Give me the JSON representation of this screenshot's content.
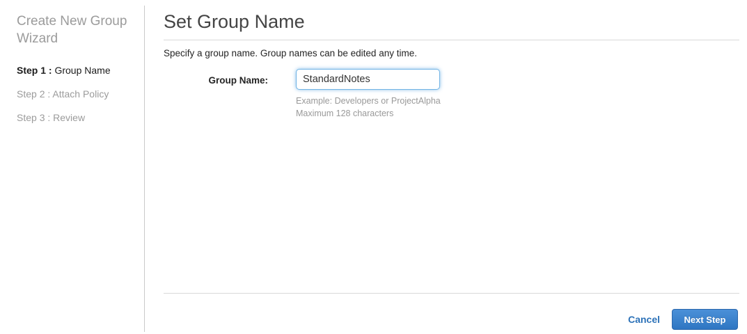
{
  "sidebar": {
    "title": "Create New Group Wizard",
    "steps": [
      {
        "prefix": "Step 1 :",
        "label": "Group Name",
        "active": true
      },
      {
        "prefix": "Step 2 :",
        "label": "Attach Policy",
        "active": false
      },
      {
        "prefix": "Step 3 :",
        "label": "Review",
        "active": false
      }
    ]
  },
  "main": {
    "title": "Set Group Name",
    "description": "Specify a group name. Group names can be edited any time.",
    "form": {
      "group_name_label": "Group Name:",
      "group_name_value": "StandardNotes",
      "hint_example": "Example: Developers or ProjectAlpha",
      "hint_max": "Maximum 128 characters"
    },
    "footer": {
      "cancel_label": "Cancel",
      "next_label": "Next Step"
    }
  },
  "colors": {
    "link_blue": "#2d72b8",
    "button_gradient_top": "#4b90d8",
    "button_gradient_bottom": "#2f76c2",
    "button_border": "#2b66ab",
    "input_focus_border": "#71b4e5",
    "inactive_gray": "#9b9b9b",
    "heading_gray": "#444444"
  }
}
